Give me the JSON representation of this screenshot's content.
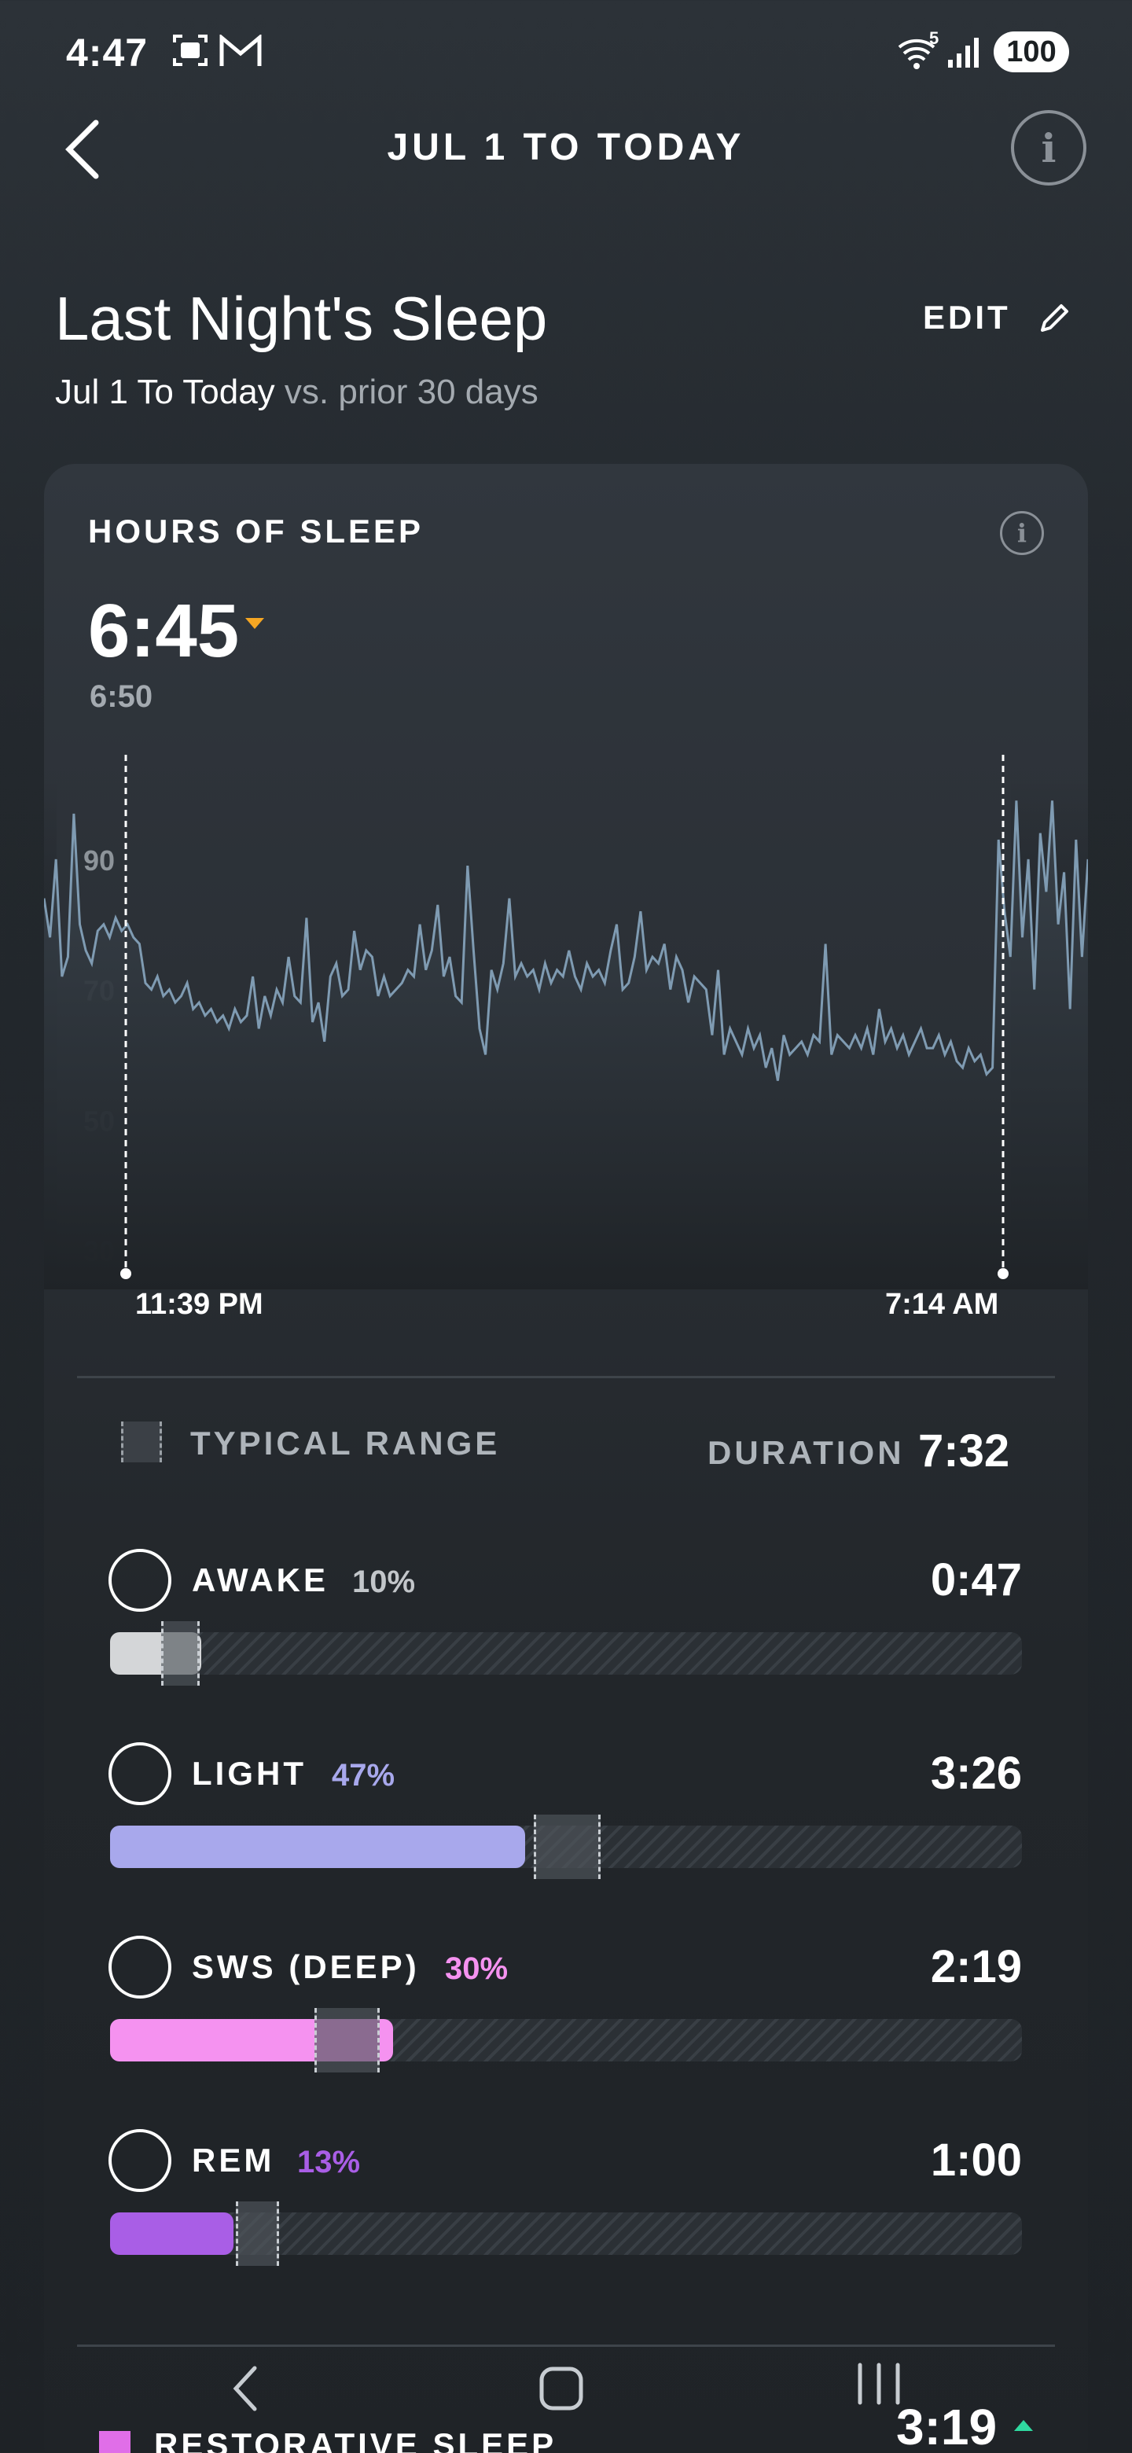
{
  "status_bar": {
    "time": "4:47",
    "left_icons": [
      "screenshot-icon",
      "gmail-icon"
    ],
    "right_icons": [
      "wifi-icon",
      "signal-icon"
    ],
    "wifi_label": "5",
    "battery": "100"
  },
  "header": {
    "title": "JUL 1 TO TODAY",
    "info_glyph": "i"
  },
  "page": {
    "title": "Last Night's Sleep",
    "edit_label": "EDIT",
    "subtitle_range": "Jul 1 To Today",
    "subtitle_compare": " vs. prior 30 days"
  },
  "card": {
    "title": "HOURS OF SLEEP",
    "info_glyph": "i",
    "value": "6:45",
    "trend": "down",
    "trend_color": "#f5a623",
    "baseline": "6:50"
  },
  "chart_data": {
    "type": "line",
    "ylabel": "",
    "yticks": [
      90,
      70,
      50,
      30
    ],
    "ylim": [
      30,
      100
    ],
    "start_label": "11:39 PM",
    "end_label": "7:14 AM",
    "line_color": "#7f9bb2",
    "series": [
      {
        "values": [
          84,
          78,
          90,
          72,
          75,
          97,
          80,
          76,
          74,
          79,
          80,
          78,
          81,
          79,
          80,
          78,
          77,
          71,
          70,
          72,
          69,
          70,
          68,
          69,
          71,
          67,
          68,
          66,
          67,
          65,
          66,
          64,
          67,
          65,
          66,
          72,
          64,
          69,
          66,
          70,
          68,
          75,
          69,
          68,
          81,
          65,
          68,
          62,
          72,
          74,
          69,
          70,
          79,
          73,
          76,
          75,
          69,
          72,
          69,
          70,
          71,
          73,
          72,
          80,
          73,
          76,
          83,
          72,
          75,
          69,
          68,
          89,
          76,
          64,
          60,
          73,
          70,
          74,
          84,
          72,
          74,
          72,
          73,
          70,
          74,
          71,
          73,
          72,
          76,
          72,
          70,
          74,
          72,
          73,
          71,
          76,
          80,
          70,
          71,
          75,
          82,
          73,
          75,
          74,
          77,
          70,
          75,
          73,
          68,
          72,
          71,
          70,
          63,
          73,
          60,
          64,
          62,
          60,
          64,
          61,
          63,
          58,
          61,
          56,
          63,
          60,
          61,
          62,
          60,
          63,
          62,
          77,
          60,
          63,
          62,
          61,
          63,
          61,
          64,
          60,
          67,
          62,
          64,
          61,
          63,
          60,
          62,
          64,
          61,
          61,
          63,
          60,
          62,
          59,
          58,
          61,
          59,
          60,
          57,
          58,
          93,
          82,
          75,
          99,
          78,
          90,
          70,
          94,
          85,
          99,
          80,
          88,
          67,
          93,
          75,
          90
        ]
      }
    ]
  },
  "stages": {
    "legend_label": "TYPICAL RANGE",
    "duration_label": "DURATION",
    "duration_value": "7:32",
    "items": [
      {
        "name": "AWAKE",
        "pct": "10%",
        "time": "0:47",
        "color": "#d4d6d8",
        "pct_color": "#c2c6ca",
        "fraction": 0.1,
        "range_from": 0.056,
        "range_to": 0.098
      },
      {
        "name": "LIGHT",
        "pct": "47%",
        "time": "3:26",
        "color": "#a8a8ec",
        "pct_color": "#a8a8ec",
        "fraction": 0.455,
        "range_from": 0.465,
        "range_to": 0.538
      },
      {
        "name": "SWS (DEEP)",
        "pct": "30%",
        "time": "2:19",
        "color": "#f592f0",
        "pct_color": "#f592f0",
        "fraction": 0.31,
        "range_from": 0.224,
        "range_to": 0.296
      },
      {
        "name": "REM",
        "pct": "13%",
        "time": "1:00",
        "color": "#a95ee6",
        "pct_color": "#a95ee6",
        "fraction": 0.135,
        "range_from": 0.138,
        "range_to": 0.185
      }
    ]
  },
  "restorative": {
    "label": "RESTORATIVE SLEEP",
    "value": "3:19",
    "trend": "up",
    "trend_color": "#2fd9a0",
    "swatch_color": "#e06ee8"
  },
  "nav_bar": {
    "buttons": [
      "back-nav-icon",
      "home-nav-icon",
      "recents-nav-icon"
    ]
  }
}
